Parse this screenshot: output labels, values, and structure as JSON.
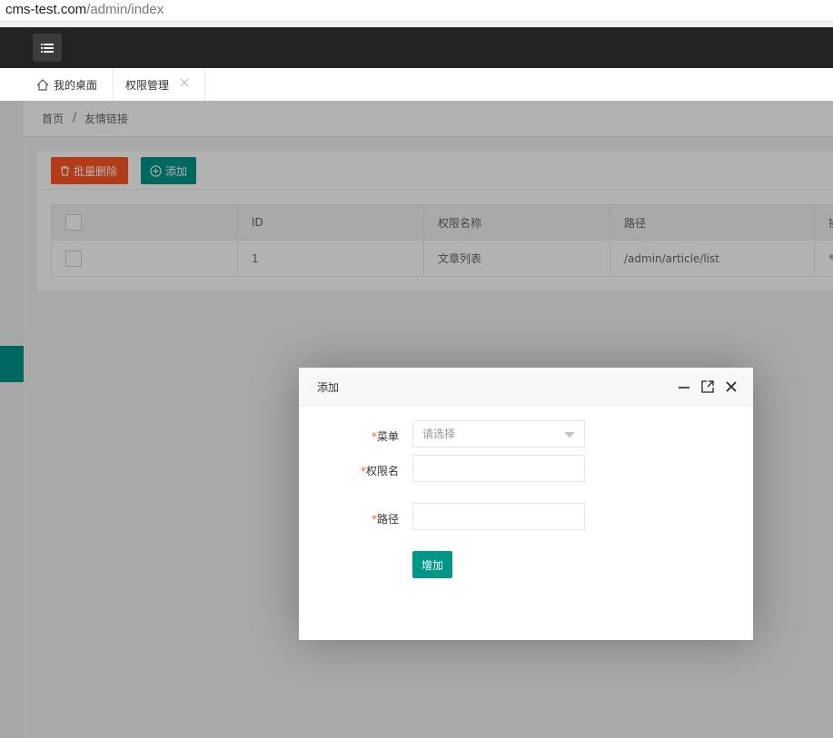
{
  "browser": {
    "url_host": "cms-test.com",
    "url_path": "/admin/index"
  },
  "header": {
    "menu_icon": "hamburger-icon"
  },
  "tabs": [
    {
      "label": "我的桌面",
      "icon": "home-icon"
    },
    {
      "label": "权限管理",
      "icon": "close-icon"
    }
  ],
  "breadcrumb": {
    "home": "首页",
    "separator": "/",
    "current": "友情链接"
  },
  "toolbar": {
    "batch_delete_label": "批量删除",
    "add_label": "添加"
  },
  "table": {
    "columns": [
      "ID",
      "权限名称",
      "路径",
      "操"
    ],
    "rows": [
      {
        "id": "1",
        "name": "文章列表",
        "path": "/admin/article/list",
        "op": "✎"
      }
    ]
  },
  "dialog": {
    "title": "添加",
    "fields": {
      "menu": {
        "label": "菜单",
        "placeholder": "请选择",
        "required": "*"
      },
      "perm_name": {
        "label": "权限名",
        "value": "",
        "required": "*"
      },
      "path": {
        "label": "路径",
        "value": "",
        "required": "*"
      }
    },
    "submit_label": "增加"
  },
  "colors": {
    "primary": "#009688",
    "danger": "#ff5722",
    "topbar": "#232323"
  }
}
